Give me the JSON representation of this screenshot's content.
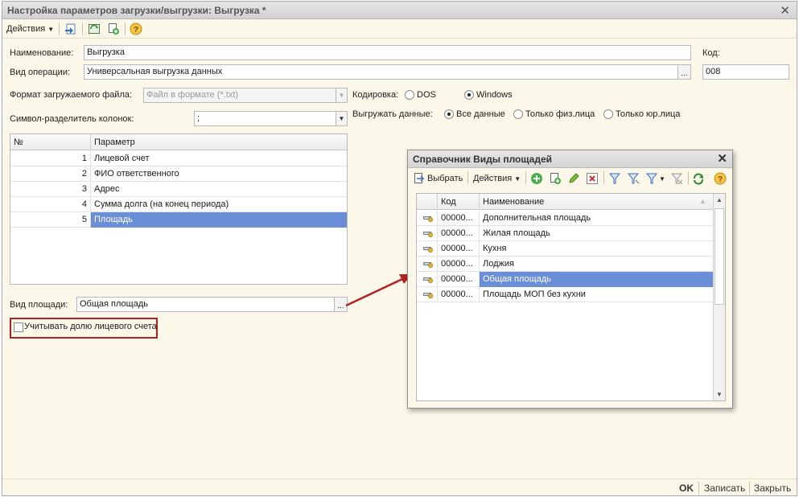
{
  "window": {
    "title": "Настройка параметров загрузки/выгрузки: Выгрузка *"
  },
  "toolbar": {
    "actions_label": "Действия"
  },
  "form": {
    "name_label": "Наименование:",
    "name_value": "Выгрузка",
    "code_label": "Код:",
    "operation_label": "Вид операции:",
    "operation_value": "Универсальная выгрузка данных",
    "code_value": "008",
    "file_format_label": "Формат загружаемого файла:",
    "file_format_value": "Файл в формате (*.txt)",
    "encoding_label": "Кодировка:",
    "encoding_options": [
      "DOS",
      "Windows"
    ],
    "encoding_selected": "Windows",
    "separator_label": "Символ-разделитель колонок:",
    "separator_value": ";",
    "export_label": "Выгружать данные:",
    "export_options": [
      "Все данные",
      "Только физ.лица",
      "Только юр.лица"
    ],
    "export_selected": "Все данные",
    "area_type_label": "Вид площади:",
    "area_type_value": "Общая площадь",
    "account_share_label": "Учитывать долю лицевого счета"
  },
  "params_table": {
    "columns": [
      "№",
      "Параметр"
    ],
    "rows": [
      {
        "num": "1",
        "name": "Лицевой счет"
      },
      {
        "num": "2",
        "name": "ФИО ответственного"
      },
      {
        "num": "3",
        "name": "Адрес"
      },
      {
        "num": "4",
        "name": "Сумма долга (на конец периода)"
      },
      {
        "num": "5",
        "name": "Площадь"
      }
    ],
    "selected_index": 4
  },
  "bottom": {
    "ok": "OK",
    "save": "Записать",
    "close": "Закрыть"
  },
  "dialog": {
    "title": "Справочник Виды площадей",
    "select_label": "Выбрать",
    "actions_label": "Действия",
    "columns": [
      "Код",
      "Наименование"
    ],
    "rows": [
      {
        "code": "00000...",
        "name": "Дополнительная площадь"
      },
      {
        "code": "00000...",
        "name": "Жилая площадь"
      },
      {
        "code": "00000...",
        "name": "Кухня"
      },
      {
        "code": "00000...",
        "name": "Лоджия"
      },
      {
        "code": "00000...",
        "name": "Общая площадь"
      },
      {
        "code": "00000...",
        "name": "Площадь МОП без кухни"
      }
    ],
    "selected_index": 4
  },
  "colors": {
    "accent_selection": "#6b8fd6",
    "highlight_frame": "#b22222",
    "window_bg": "#fbf8e9"
  }
}
